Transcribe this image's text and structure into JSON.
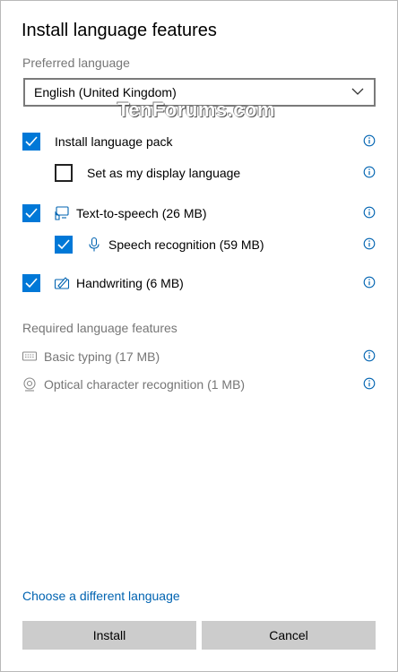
{
  "dialog": {
    "title": "Install language features",
    "preferred_label": "Preferred language",
    "preferred_value": "English (United Kingdom)",
    "watermark": "TenForums.com"
  },
  "options": {
    "language_pack": {
      "label": "Install language pack",
      "checked": true,
      "icon": "none"
    },
    "display_language": {
      "label": "Set as my display language",
      "checked": false,
      "icon": "none"
    },
    "tts": {
      "label": "Text-to-speech (26 MB)",
      "checked": true,
      "icon": "tts-icon"
    },
    "speech": {
      "label": "Speech recognition (59 MB)",
      "checked": true,
      "icon": "microphone-icon"
    },
    "handwriting": {
      "label": "Handwriting (6 MB)",
      "checked": true,
      "icon": "handwriting-icon"
    }
  },
  "required": {
    "heading": "Required language features",
    "basic_typing": {
      "label": "Basic typing (17 MB)",
      "icon": "keyboard-icon"
    },
    "ocr": {
      "label": "Optical character recognition (1 MB)",
      "icon": "camera-icon"
    }
  },
  "footer": {
    "choose_link": "Choose a different language",
    "install_label": "Install",
    "cancel_label": "Cancel"
  },
  "colors": {
    "accent": "#0078d7",
    "link": "#0063b1",
    "button_bg": "#cccccc",
    "muted_text": "#767676"
  }
}
